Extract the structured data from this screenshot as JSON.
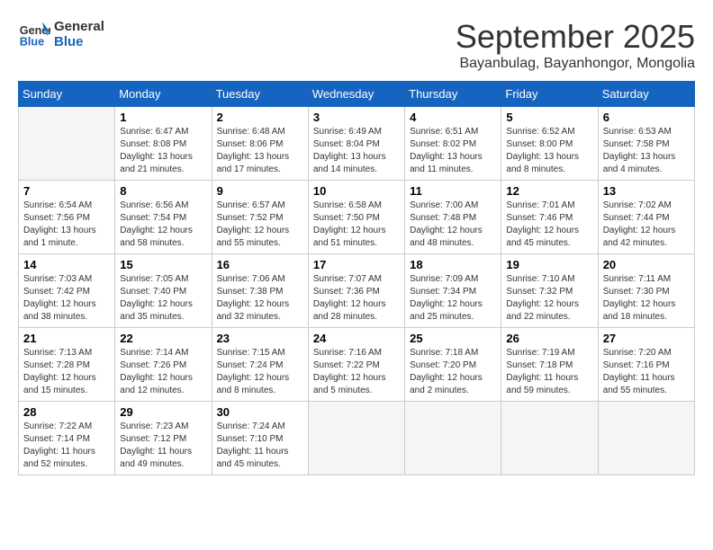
{
  "logo": {
    "line1": "General",
    "line2": "Blue"
  },
  "title": "September 2025",
  "subtitle": "Bayanbulag, Bayanhongor, Mongolia",
  "weekdays": [
    "Sunday",
    "Monday",
    "Tuesday",
    "Wednesday",
    "Thursday",
    "Friday",
    "Saturday"
  ],
  "weeks": [
    [
      {
        "day": "",
        "info": ""
      },
      {
        "day": "1",
        "info": "Sunrise: 6:47 AM\nSunset: 8:08 PM\nDaylight: 13 hours\nand 21 minutes."
      },
      {
        "day": "2",
        "info": "Sunrise: 6:48 AM\nSunset: 8:06 PM\nDaylight: 13 hours\nand 17 minutes."
      },
      {
        "day": "3",
        "info": "Sunrise: 6:49 AM\nSunset: 8:04 PM\nDaylight: 13 hours\nand 14 minutes."
      },
      {
        "day": "4",
        "info": "Sunrise: 6:51 AM\nSunset: 8:02 PM\nDaylight: 13 hours\nand 11 minutes."
      },
      {
        "day": "5",
        "info": "Sunrise: 6:52 AM\nSunset: 8:00 PM\nDaylight: 13 hours\nand 8 minutes."
      },
      {
        "day": "6",
        "info": "Sunrise: 6:53 AM\nSunset: 7:58 PM\nDaylight: 13 hours\nand 4 minutes."
      }
    ],
    [
      {
        "day": "7",
        "info": "Sunrise: 6:54 AM\nSunset: 7:56 PM\nDaylight: 13 hours\nand 1 minute."
      },
      {
        "day": "8",
        "info": "Sunrise: 6:56 AM\nSunset: 7:54 PM\nDaylight: 12 hours\nand 58 minutes."
      },
      {
        "day": "9",
        "info": "Sunrise: 6:57 AM\nSunset: 7:52 PM\nDaylight: 12 hours\nand 55 minutes."
      },
      {
        "day": "10",
        "info": "Sunrise: 6:58 AM\nSunset: 7:50 PM\nDaylight: 12 hours\nand 51 minutes."
      },
      {
        "day": "11",
        "info": "Sunrise: 7:00 AM\nSunset: 7:48 PM\nDaylight: 12 hours\nand 48 minutes."
      },
      {
        "day": "12",
        "info": "Sunrise: 7:01 AM\nSunset: 7:46 PM\nDaylight: 12 hours\nand 45 minutes."
      },
      {
        "day": "13",
        "info": "Sunrise: 7:02 AM\nSunset: 7:44 PM\nDaylight: 12 hours\nand 42 minutes."
      }
    ],
    [
      {
        "day": "14",
        "info": "Sunrise: 7:03 AM\nSunset: 7:42 PM\nDaylight: 12 hours\nand 38 minutes."
      },
      {
        "day": "15",
        "info": "Sunrise: 7:05 AM\nSunset: 7:40 PM\nDaylight: 12 hours\nand 35 minutes."
      },
      {
        "day": "16",
        "info": "Sunrise: 7:06 AM\nSunset: 7:38 PM\nDaylight: 12 hours\nand 32 minutes."
      },
      {
        "day": "17",
        "info": "Sunrise: 7:07 AM\nSunset: 7:36 PM\nDaylight: 12 hours\nand 28 minutes."
      },
      {
        "day": "18",
        "info": "Sunrise: 7:09 AM\nSunset: 7:34 PM\nDaylight: 12 hours\nand 25 minutes."
      },
      {
        "day": "19",
        "info": "Sunrise: 7:10 AM\nSunset: 7:32 PM\nDaylight: 12 hours\nand 22 minutes."
      },
      {
        "day": "20",
        "info": "Sunrise: 7:11 AM\nSunset: 7:30 PM\nDaylight: 12 hours\nand 18 minutes."
      }
    ],
    [
      {
        "day": "21",
        "info": "Sunrise: 7:13 AM\nSunset: 7:28 PM\nDaylight: 12 hours\nand 15 minutes."
      },
      {
        "day": "22",
        "info": "Sunrise: 7:14 AM\nSunset: 7:26 PM\nDaylight: 12 hours\nand 12 minutes."
      },
      {
        "day": "23",
        "info": "Sunrise: 7:15 AM\nSunset: 7:24 PM\nDaylight: 12 hours\nand 8 minutes."
      },
      {
        "day": "24",
        "info": "Sunrise: 7:16 AM\nSunset: 7:22 PM\nDaylight: 12 hours\nand 5 minutes."
      },
      {
        "day": "25",
        "info": "Sunrise: 7:18 AM\nSunset: 7:20 PM\nDaylight: 12 hours\nand 2 minutes."
      },
      {
        "day": "26",
        "info": "Sunrise: 7:19 AM\nSunset: 7:18 PM\nDaylight: 11 hours\nand 59 minutes."
      },
      {
        "day": "27",
        "info": "Sunrise: 7:20 AM\nSunset: 7:16 PM\nDaylight: 11 hours\nand 55 minutes."
      }
    ],
    [
      {
        "day": "28",
        "info": "Sunrise: 7:22 AM\nSunset: 7:14 PM\nDaylight: 11 hours\nand 52 minutes."
      },
      {
        "day": "29",
        "info": "Sunrise: 7:23 AM\nSunset: 7:12 PM\nDaylight: 11 hours\nand 49 minutes."
      },
      {
        "day": "30",
        "info": "Sunrise: 7:24 AM\nSunset: 7:10 PM\nDaylight: 11 hours\nand 45 minutes."
      },
      {
        "day": "",
        "info": ""
      },
      {
        "day": "",
        "info": ""
      },
      {
        "day": "",
        "info": ""
      },
      {
        "day": "",
        "info": ""
      }
    ]
  ]
}
